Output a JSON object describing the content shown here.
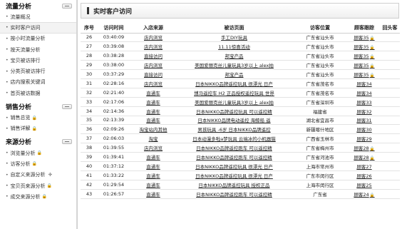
{
  "sidebar": {
    "sections": [
      {
        "title": "流量分析",
        "items": [
          {
            "label": "流量概况",
            "active": false,
            "locked": false,
            "plus": false
          },
          {
            "label": "实时客户访问",
            "active": true,
            "locked": false,
            "plus": false
          },
          {
            "label": "按小时流量分析",
            "active": false,
            "locked": false,
            "plus": false
          },
          {
            "label": "按天流量分析",
            "active": false,
            "locked": false,
            "plus": false
          },
          {
            "label": "宝贝被访排行",
            "active": false,
            "locked": false,
            "plus": false
          },
          {
            "label": "分类页被访排行",
            "active": false,
            "locked": false,
            "plus": false
          },
          {
            "label": "店内搜索关键词",
            "active": false,
            "locked": false,
            "plus": false
          },
          {
            "label": "首页被访数据",
            "active": false,
            "locked": false,
            "plus": false
          }
        ]
      },
      {
        "title": "销售分析",
        "items": [
          {
            "label": "销售总览",
            "active": false,
            "locked": true,
            "plus": false
          },
          {
            "label": "销售详解",
            "active": false,
            "locked": true,
            "plus": false
          }
        ]
      },
      {
        "title": "来源分析",
        "items": [
          {
            "label": "浏览量分析",
            "active": false,
            "locked": true,
            "plus": false
          },
          {
            "label": "访客分析",
            "active": false,
            "locked": true,
            "plus": false
          },
          {
            "label": "自定义来源分析",
            "active": false,
            "locked": false,
            "plus": true
          },
          {
            "label": "宝贝页来源分析",
            "active": false,
            "locked": true,
            "plus": false
          },
          {
            "label": "成交来源分析",
            "active": false,
            "locked": true,
            "plus": false
          }
        ]
      }
    ]
  },
  "main": {
    "title": "实时客户访问",
    "columns": [
      "序号",
      "访问时间",
      "入店来源",
      "被访页面",
      "访客位置",
      "顾客跟踪",
      "回头客"
    ],
    "rows": [
      {
        "no": "26",
        "time": "03:40:09",
        "source": "店内浏览",
        "page": "手工DIY玩具",
        "location": "广东省汕头市",
        "track": "顾客35",
        "locked": true
      },
      {
        "no": "27",
        "time": "03:39:08",
        "source": "店内浏览",
        "page": "11.11惊喜活动",
        "location": "广东省汕头市",
        "track": "顾客35",
        "locked": true
      },
      {
        "no": "28",
        "time": "03:38:28",
        "source": "直接访问",
        "page": "邦宝产品",
        "location": "广东省汕头市",
        "track": "顾客35",
        "locked": true
      },
      {
        "no": "29",
        "time": "03:38:00",
        "source": "店内浏览",
        "page": "美国爱丽克丝儿童玩具3岁以上 alex拍",
        "location": "广东省汕头市",
        "track": "顾客35",
        "locked": true
      },
      {
        "no": "30",
        "time": "03:37:29",
        "source": "直接访问",
        "page": "邦宝产品",
        "location": "广东省汕头市",
        "track": "顾客35",
        "locked": true
      },
      {
        "no": "31",
        "time": "02:28:16",
        "source": "店内浏览",
        "page": "日本NIKKO品牌遥控玩具 很漂光 日产",
        "location": "广东省茂名市",
        "track": "顾客34",
        "locked": false
      },
      {
        "no": "32",
        "time": "02:21:40",
        "source": "直通车",
        "page": "博马遥控车 H2 正品授权遥控玩具 世界",
        "location": "广东省茂名市",
        "track": "顾客34",
        "locked": false
      },
      {
        "no": "33",
        "time": "02:17:06",
        "source": "直通车",
        "page": "美国爱丽克丝儿童玩具3岁以上 alex拍",
        "location": "广东省深圳市",
        "track": "顾客33",
        "locked": false
      },
      {
        "no": "34",
        "time": "02:14:36",
        "source": "直通车",
        "page": "日本NIKKO品牌遥控玩具 可以遥控精",
        "location": "福建省",
        "track": "顾客32",
        "locked": false
      },
      {
        "no": "35",
        "time": "02:13:39",
        "source": "直通车",
        "page": "日本NIKKO品牌电动遥控 海鲸船 遥",
        "location": "湖北省宜昌市",
        "track": "顾客31",
        "locked": false
      },
      {
        "no": "36",
        "time": "02:09:26",
        "source": "淘宝站内其他",
        "page": "男孩玩具 -6岁 日本NIKKO品牌遥控",
        "location": "新疆喀什地区",
        "track": "顾客30",
        "locked": false
      },
      {
        "no": "37",
        "time": "02:06:03",
        "source": "淘宝",
        "page": "日本动漫多啦a梦玩具 云端冰的小机器猫",
        "location": "广西省玉林市",
        "track": "顾客29",
        "locked": false
      },
      {
        "no": "38",
        "time": "01:39:55",
        "source": "店内浏览",
        "page": "日本NIKKO品牌遥控跑车 可以遥控精",
        "location": "广东省梅州市",
        "track": "顾客28",
        "locked": true
      },
      {
        "no": "39",
        "time": "01:39:41",
        "source": "直通车",
        "page": "日本NIKKO品牌遥控跑车 可以遥控精",
        "location": "广东省河池市",
        "track": "顾客28",
        "locked": true
      },
      {
        "no": "40",
        "time": "01:37:12",
        "source": "直通车",
        "page": "日本NIKKO品牌遥控玩具 很漂光 日产",
        "location": "上海市常州市",
        "track": "顾客27",
        "locked": false
      },
      {
        "no": "41",
        "time": "01:33:22",
        "source": "直通车",
        "page": "日本NIKKO品牌遥控玩具 很漂光 日产",
        "location": "广东市闵行区",
        "track": "顾客26",
        "locked": false
      },
      {
        "no": "42",
        "time": "01:29:54",
        "source": "直通车",
        "page": "日本NIKKO品牌遥控玩具 授权正品",
        "location": "上海市闵行区",
        "track": "顾客25",
        "locked": false
      },
      {
        "no": "43",
        "time": "01:26:57",
        "source": "直通车",
        "page": "日本NIKKO品牌遥控跑车 可以遥控精",
        "location": "广东省",
        "track": "顾客24",
        "locked": true
      }
    ]
  }
}
